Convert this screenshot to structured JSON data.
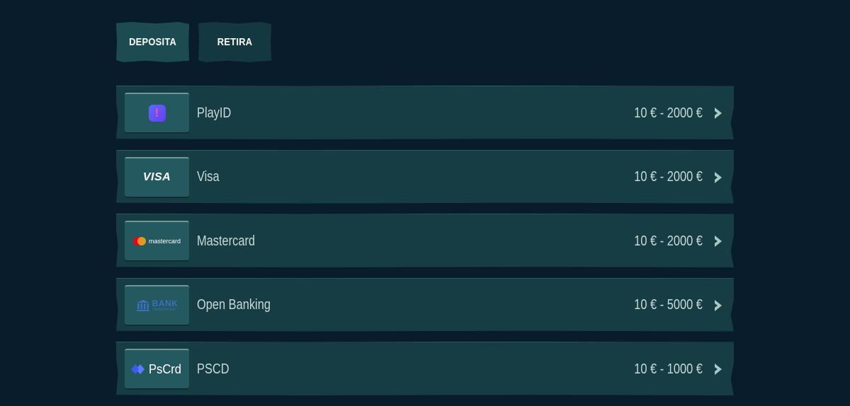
{
  "tabs": [
    {
      "label": "DEPOSITA",
      "active": true
    },
    {
      "label": "RETIRA",
      "active": false
    }
  ],
  "methods": [
    {
      "name": "PlayID",
      "range": "10 € - 2000 €",
      "logo_icon": "playid-logo-icon"
    },
    {
      "name": "Visa",
      "range": "10 € - 2000 €",
      "logo_icon": "visa-logo-icon",
      "logo_text": "VISA"
    },
    {
      "name": "Mastercard",
      "range": "10 € - 2000 €",
      "logo_icon": "mastercard-logo-icon",
      "logo_text": "mastercard"
    },
    {
      "name": "Open Banking",
      "range": "10 € - 5000 €",
      "logo_icon": "bank-transfer-logo-icon",
      "logo_text": "BANK",
      "logo_subtext": "TRANSFER"
    },
    {
      "name": "PSCD",
      "range": "10 € - 1000 €",
      "logo_icon": "pscrd-logo-icon",
      "logo_text": "PsCrd"
    }
  ],
  "colors": {
    "background": "#081c2b",
    "row": "#163c44",
    "tab_active": "#1c4c52",
    "text": "#c7dada",
    "chevron": "#a9c8c8"
  },
  "icons": {
    "row_arrow": "chevron-right-icon"
  }
}
